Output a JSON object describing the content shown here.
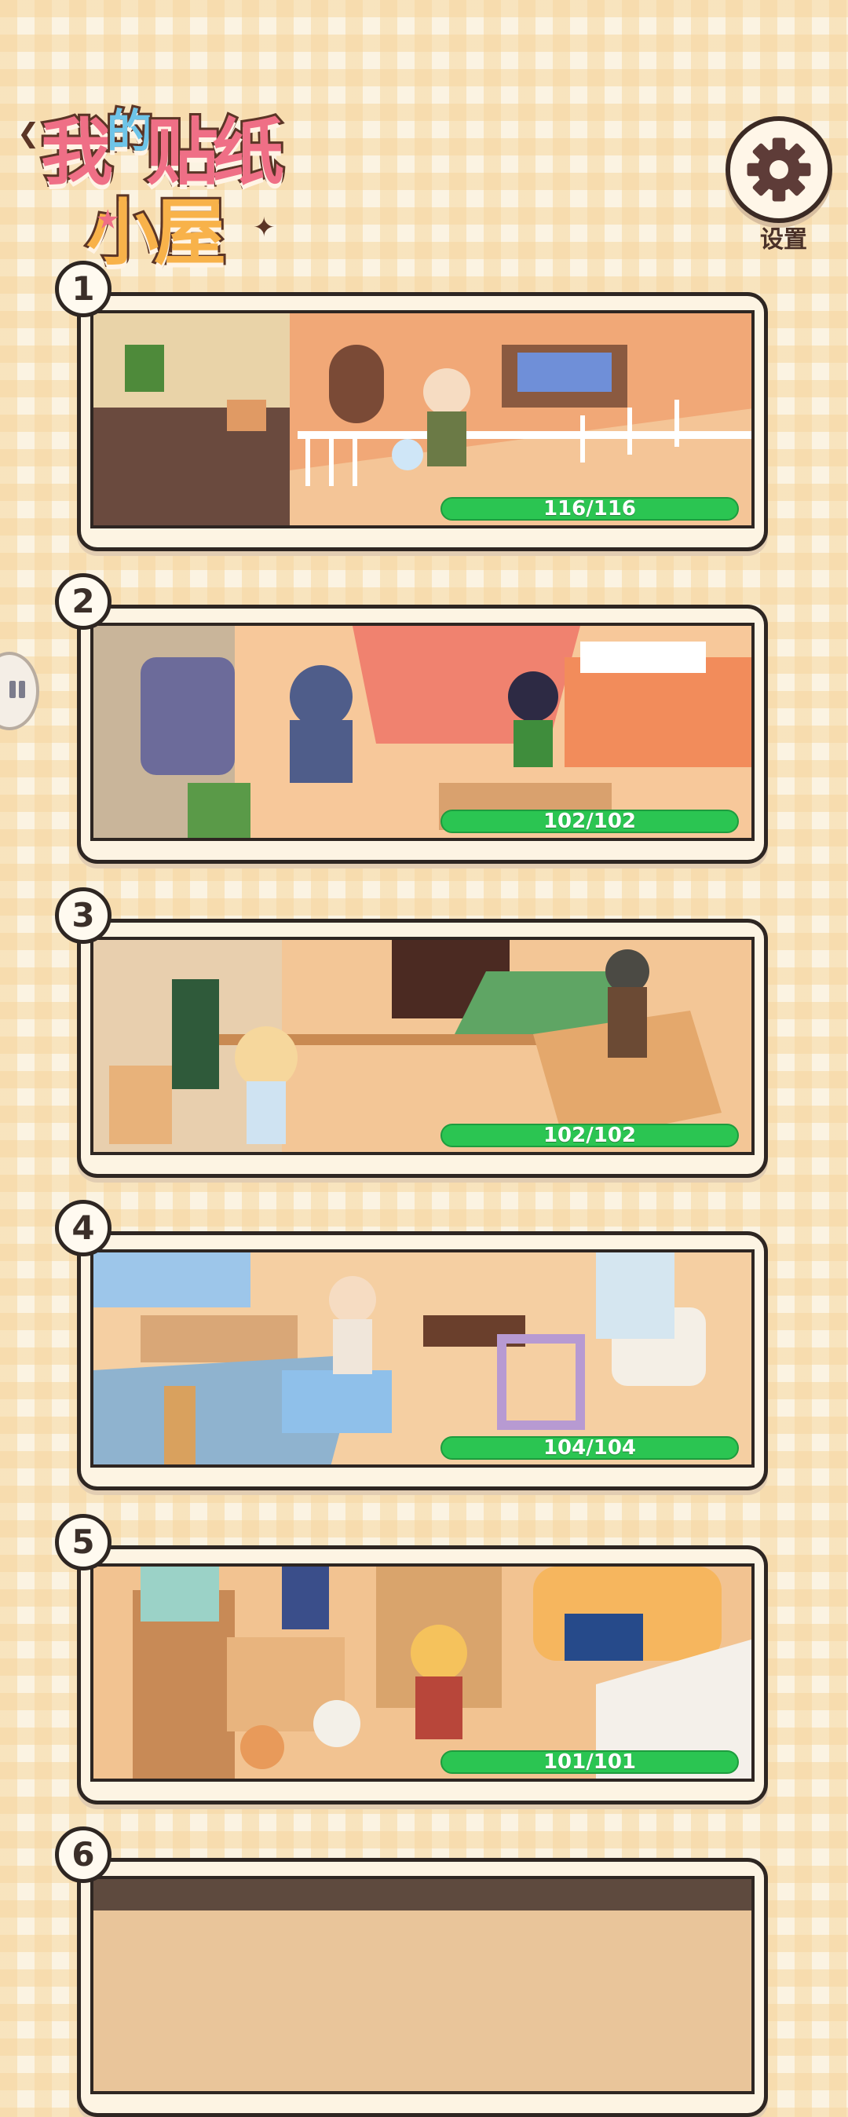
{
  "logo": {
    "line1_a": "我",
    "line1_b": "的",
    "line1_c": "贴纸",
    "line2": "小屋"
  },
  "settings": {
    "label": "设置",
    "icon": "gear-icon"
  },
  "side_tab": {
    "icon": "pause-icon"
  },
  "rooms": [
    {
      "number": "1",
      "progress_text": "116/116",
      "progress": 1.0
    },
    {
      "number": "2",
      "progress_text": "102/102",
      "progress": 1.0
    },
    {
      "number": "3",
      "progress_text": "102/102",
      "progress": 1.0
    },
    {
      "number": "4",
      "progress_text": "104/104",
      "progress": 1.0
    },
    {
      "number": "5",
      "progress_text": "101/101",
      "progress": 1.0
    },
    {
      "number": "6"
    }
  ],
  "colors": {
    "progress_fill": "#2bc552",
    "card_bg": "#fdf4e3",
    "outline": "#2e2622"
  }
}
